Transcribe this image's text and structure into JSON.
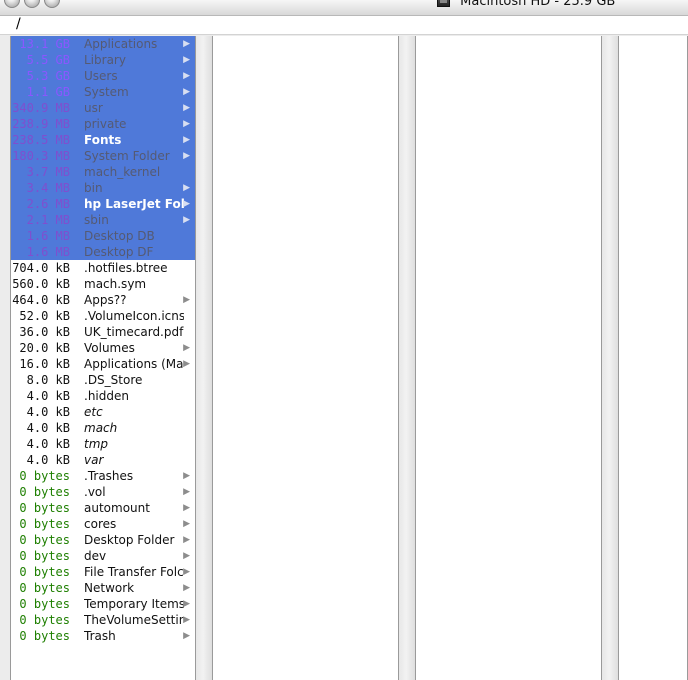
{
  "window": {
    "title": "Macintosh HD - 25.9 GB"
  },
  "path": {
    "text": "/"
  },
  "colors": {
    "selection": "#4f79d9",
    "gb": "#8a57ff",
    "mb": "#7f4fcf",
    "bytes": "#1e7f00",
    "panel_border": "#9a9a9a"
  },
  "columns": [
    {
      "rows": [
        {
          "size": "13.1 GB",
          "name": "Applications",
          "has_arrow": true,
          "selected": true,
          "size_class": "gb",
          "name_class": "dim-name"
        },
        {
          "size": "5.5 GB",
          "name": "Library",
          "has_arrow": true,
          "selected": true,
          "size_class": "gb",
          "name_class": "dim-name"
        },
        {
          "size": "5.3 GB",
          "name": "Users",
          "has_arrow": true,
          "selected": true,
          "size_class": "gb",
          "name_class": "dim-name"
        },
        {
          "size": "1.1 GB",
          "name": "System",
          "has_arrow": true,
          "selected": true,
          "size_class": "gb",
          "name_class": "dim-name"
        },
        {
          "size": "340.9 MB",
          "name": "usr",
          "has_arrow": true,
          "selected": true,
          "size_class": "mb",
          "name_class": "dim-name"
        },
        {
          "size": "238.9 MB",
          "name": "private",
          "has_arrow": true,
          "selected": true,
          "size_class": "mb",
          "name_class": "dim-name"
        },
        {
          "size": "238.5 MB",
          "name": "Fonts",
          "has_arrow": true,
          "selected": true,
          "size_class": "mb",
          "name_class": "white-name"
        },
        {
          "size": "180.3 MB",
          "name": "System Folder",
          "has_arrow": true,
          "selected": true,
          "size_class": "mb",
          "name_class": "dim-name"
        },
        {
          "size": "3.7 MB",
          "name": "mach_kernel",
          "has_arrow": false,
          "selected": true,
          "size_class": "mb",
          "name_class": "dim-name"
        },
        {
          "size": "3.4 MB",
          "name": "bin",
          "has_arrow": true,
          "selected": true,
          "size_class": "mb",
          "name_class": "dim-name"
        },
        {
          "size": "2.6 MB",
          "name": "hp LaserJet Folde",
          "has_arrow": true,
          "selected": true,
          "size_class": "mb",
          "name_class": "white-name"
        },
        {
          "size": "2.1 MB",
          "name": "sbin",
          "has_arrow": true,
          "selected": true,
          "size_class": "mb",
          "name_class": "dim-name"
        },
        {
          "size": "1.6 MB",
          "name": "Desktop DB",
          "has_arrow": false,
          "selected": true,
          "size_class": "mb",
          "name_class": "dim-name"
        },
        {
          "size": "1.6 MB",
          "name": "Desktop DF",
          "has_arrow": false,
          "selected": true,
          "size_class": "mb",
          "name_class": "dim-name"
        },
        {
          "size": "704.0 kB",
          "name": ".hotfiles.btree",
          "has_arrow": false,
          "selected": false,
          "size_class": "kb",
          "name_class": "dark-name"
        },
        {
          "size": "560.0 kB",
          "name": "mach.sym",
          "has_arrow": false,
          "selected": false,
          "size_class": "kb",
          "name_class": "dark-name"
        },
        {
          "size": "464.0 kB",
          "name": "Apps??",
          "has_arrow": true,
          "selected": false,
          "size_class": "kb",
          "name_class": "dark-name"
        },
        {
          "size": "52.0 kB",
          "name": ".VolumeIcon.icns",
          "has_arrow": false,
          "selected": false,
          "size_class": "kb",
          "name_class": "dark-name"
        },
        {
          "size": "36.0 kB",
          "name": "UK_timecard.pdf",
          "has_arrow": false,
          "selected": false,
          "size_class": "kb",
          "name_class": "dark-name"
        },
        {
          "size": "20.0 kB",
          "name": "Volumes",
          "has_arrow": true,
          "selected": false,
          "size_class": "kb",
          "name_class": "dark-name"
        },
        {
          "size": "16.0 kB",
          "name": "Applications (Mac",
          "has_arrow": true,
          "selected": false,
          "size_class": "kb",
          "name_class": "dark-name"
        },
        {
          "size": "8.0 kB",
          "name": ".DS_Store",
          "has_arrow": false,
          "selected": false,
          "size_class": "kb",
          "name_class": "dark-name"
        },
        {
          "size": "4.0 kB",
          "name": ".hidden",
          "has_arrow": false,
          "selected": false,
          "size_class": "kb",
          "name_class": "dark-name"
        },
        {
          "size": "4.0 kB",
          "name": "etc",
          "has_arrow": false,
          "selected": false,
          "size_class": "kb",
          "name_class": "dark-name italic"
        },
        {
          "size": "4.0 kB",
          "name": "mach",
          "has_arrow": false,
          "selected": false,
          "size_class": "kb",
          "name_class": "dark-name italic"
        },
        {
          "size": "4.0 kB",
          "name": "tmp",
          "has_arrow": false,
          "selected": false,
          "size_class": "kb",
          "name_class": "dark-name italic"
        },
        {
          "size": "4.0 kB",
          "name": "var",
          "has_arrow": false,
          "selected": false,
          "size_class": "kb",
          "name_class": "dark-name italic"
        },
        {
          "size": "0 bytes",
          "name": ".Trashes",
          "has_arrow": true,
          "selected": false,
          "size_class": "bytes",
          "name_class": "dark-name"
        },
        {
          "size": "0 bytes",
          "name": ".vol",
          "has_arrow": true,
          "selected": false,
          "size_class": "bytes",
          "name_class": "dark-name"
        },
        {
          "size": "0 bytes",
          "name": "automount",
          "has_arrow": true,
          "selected": false,
          "size_class": "bytes",
          "name_class": "dark-name"
        },
        {
          "size": "0 bytes",
          "name": "cores",
          "has_arrow": true,
          "selected": false,
          "size_class": "bytes",
          "name_class": "dark-name"
        },
        {
          "size": "0 bytes",
          "name": "Desktop Folder",
          "has_arrow": true,
          "selected": false,
          "size_class": "bytes",
          "name_class": "dark-name"
        },
        {
          "size": "0 bytes",
          "name": "dev",
          "has_arrow": true,
          "selected": false,
          "size_class": "bytes",
          "name_class": "dark-name"
        },
        {
          "size": "0 bytes",
          "name": "File Transfer Folc",
          "has_arrow": true,
          "selected": false,
          "size_class": "bytes",
          "name_class": "dark-name"
        },
        {
          "size": "0 bytes",
          "name": "Network",
          "has_arrow": true,
          "selected": false,
          "size_class": "bytes",
          "name_class": "dark-name"
        },
        {
          "size": "0 bytes",
          "name": "Temporary Items",
          "has_arrow": true,
          "selected": false,
          "size_class": "bytes",
          "name_class": "dark-name"
        },
        {
          "size": "0 bytes",
          "name": "TheVolumeSettin",
          "has_arrow": true,
          "selected": false,
          "size_class": "bytes",
          "name_class": "dark-name"
        },
        {
          "size": "0 bytes",
          "name": "Trash",
          "has_arrow": true,
          "selected": false,
          "size_class": "bytes",
          "name_class": "dark-name"
        }
      ]
    },
    {
      "rows": []
    },
    {
      "rows": []
    },
    {
      "rows": []
    }
  ]
}
